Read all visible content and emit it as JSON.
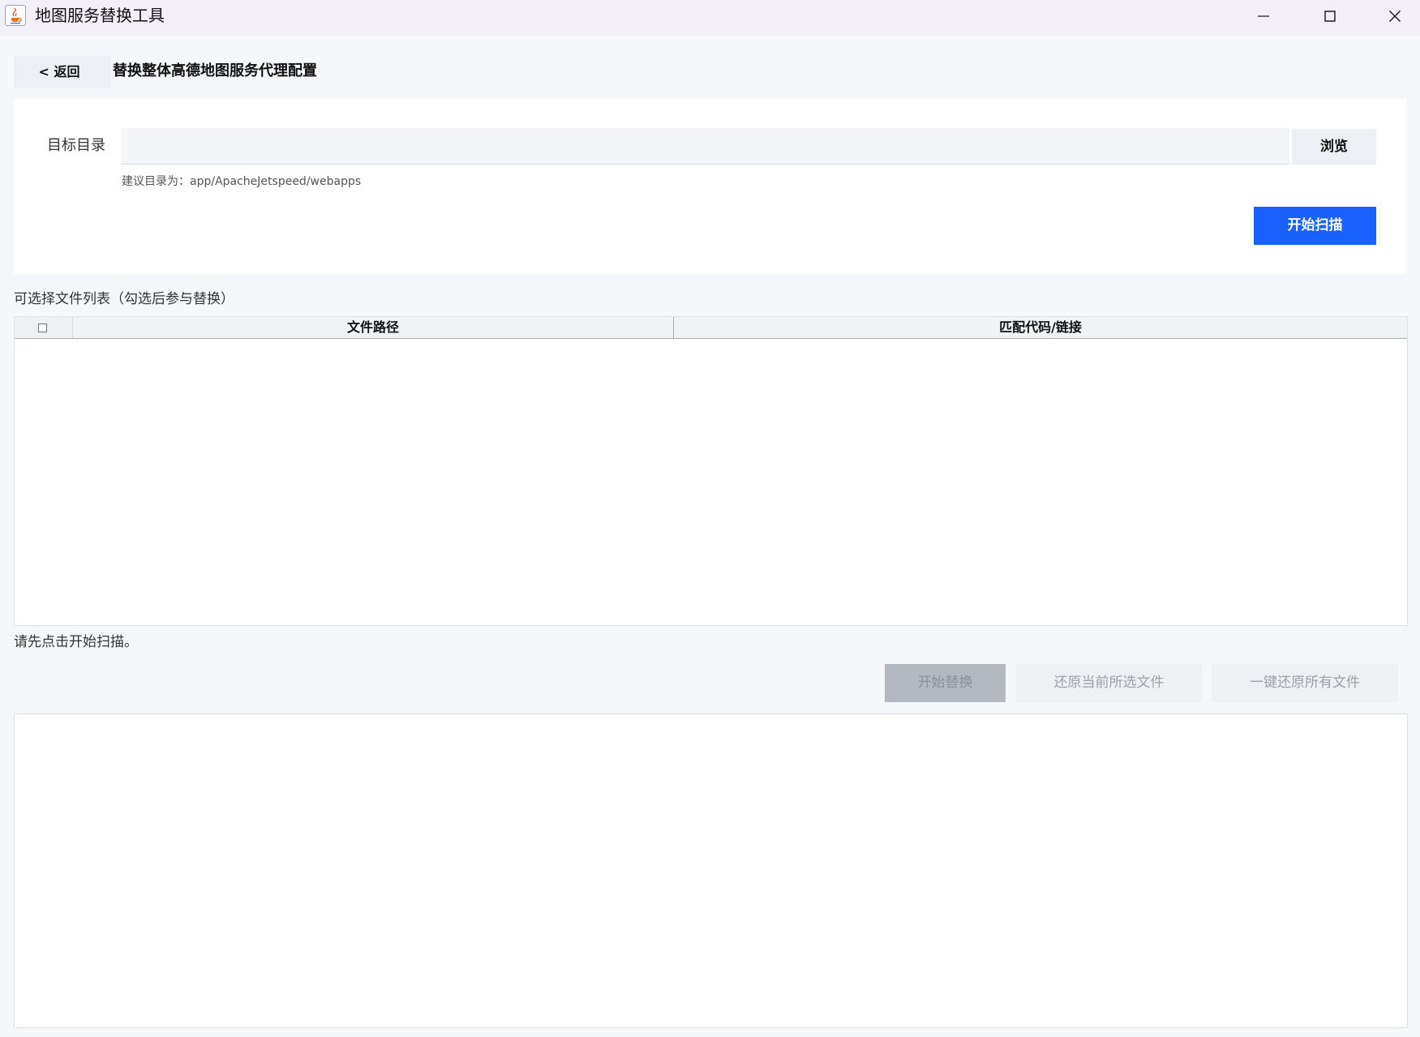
{
  "window": {
    "title": "地图服务替换工具",
    "icon": "java-coffee-cup-icon"
  },
  "header": {
    "back_label": "< 返回",
    "page_title": "替换整体高德地图服务代理配置"
  },
  "config": {
    "dir_label": "目标目录",
    "dir_value": "",
    "browse_label": "浏览",
    "hint": "建议目录为：app/ApacheJetspeed/webapps",
    "scan_label": "开始扫描"
  },
  "file_list": {
    "caption": "可选择文件列表（勾选后参与替换）",
    "columns": [
      "文件路径",
      "匹配代码/链接"
    ],
    "rows": []
  },
  "status": "请先点击开始扫描。",
  "actions": {
    "replace_label": "开始替换",
    "restore_selected_label": "还原当前所选文件",
    "restore_all_label": "一键还原所有文件"
  },
  "colors": {
    "primary": "#1a62ff",
    "disabled_primary": "#b3b8c1",
    "background": "#f5f7fa",
    "titlebar": "#f3eff7"
  }
}
